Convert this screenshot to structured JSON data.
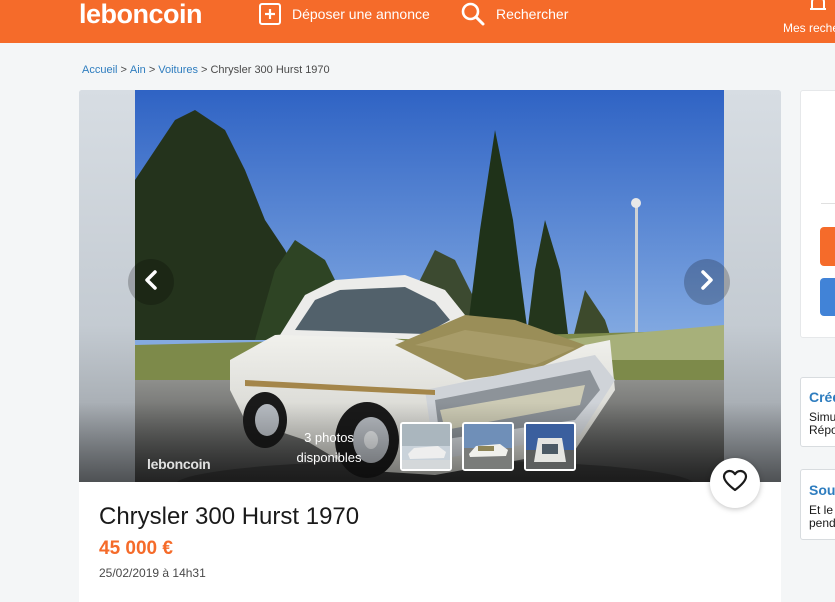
{
  "header": {
    "logo": "leboncoin",
    "deposit_label": "Déposer une annonce",
    "search_label": "Rechercher",
    "my_searches_label": "Mes recherches"
  },
  "breadcrumb": {
    "items": [
      "Accueil",
      "Ain",
      "Voitures"
    ],
    "separator": ">",
    "current": "Chrysler 300 Hurst 1970"
  },
  "gallery": {
    "watermark": "leboncoin",
    "photo_count_line1": "3 photos",
    "photo_count_line2": "disponibles",
    "thumbnail_count": 3
  },
  "ad": {
    "title": "Chrysler 300 Hurst 1970",
    "price": "45 000 €",
    "date": "25/02/2019 à 14h31"
  },
  "sidebar": {
    "box1_title": "Crédit",
    "box1_line1": "Simulez",
    "box1_line2": "Réponse",
    "box2_title": "Souscrire",
    "box2_line1": "Et le prix",
    "box2_line2": "pendant"
  },
  "colors": {
    "brand": "#f56b2a",
    "link": "#2e7dbf",
    "secondary_button": "#4183d7",
    "page_background": "#f4f6f7"
  }
}
